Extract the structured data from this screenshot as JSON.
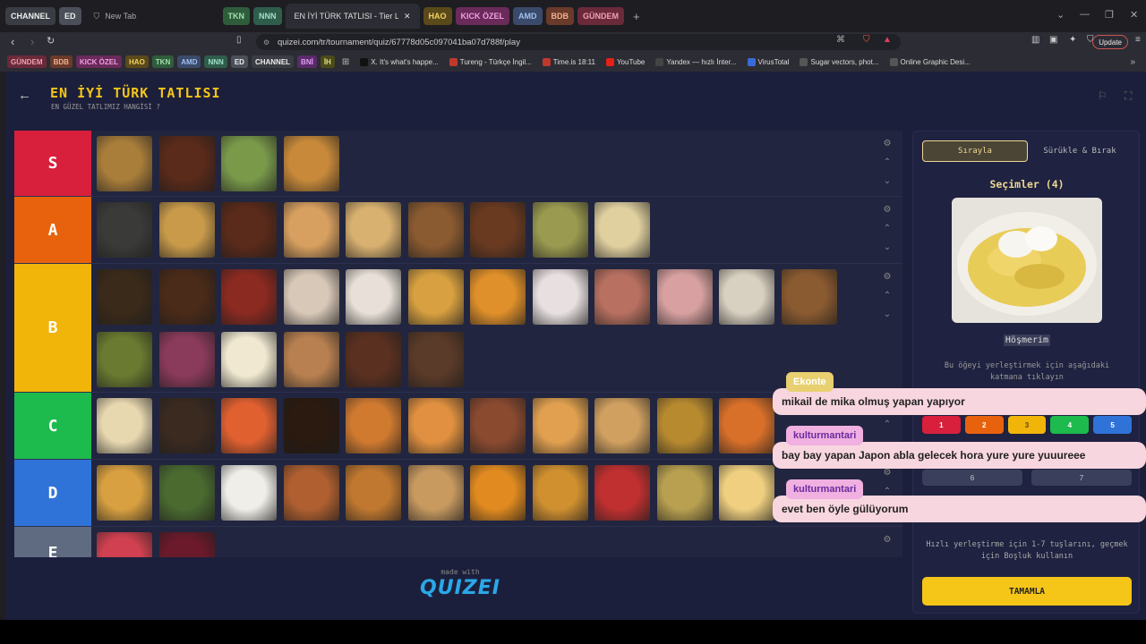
{
  "browser": {
    "tab_pills": [
      {
        "label": "CHANNEL",
        "bg": "#3a3d44",
        "fg": "#eee"
      },
      {
        "label": "ED",
        "bg": "#4a4f5a",
        "fg": "#eee"
      }
    ],
    "new_tab": "New Tab",
    "tab_pills2": [
      {
        "label": "TKN",
        "bg": "#2f5d3c",
        "fg": "#9fe0a8"
      },
      {
        "label": "NNN",
        "bg": "#2f5d4c",
        "fg": "#9fe0c8"
      }
    ],
    "active_tab": "EN İYİ TÜRK TATLISI - Tier List, K",
    "tab_pills3": [
      {
        "label": "HAO",
        "bg": "#5a4a1a",
        "fg": "#f5d060"
      },
      {
        "label": "KICK ÖZEL",
        "bg": "#6a2a5a",
        "fg": "#f0a0e0"
      },
      {
        "label": "AMD",
        "bg": "#3a4a6a",
        "fg": "#a0c0f0"
      },
      {
        "label": "BDB",
        "bg": "#6a3a2a",
        "fg": "#f0b090"
      },
      {
        "label": "GÜNDEM",
        "bg": "#6a2a3a",
        "fg": "#f0a0b0"
      }
    ],
    "url": "quizei.com/tr/tournament/quiz/67778d05c097041ba07d788f/play",
    "bookmark_pills": [
      {
        "label": "GÜNDEM",
        "bg": "#6a2a3a",
        "fg": "#f0a0b0"
      },
      {
        "label": "BDB",
        "bg": "#6a3a2a",
        "fg": "#f0b090"
      },
      {
        "label": "KICK ÖZEL",
        "bg": "#6a2a5a",
        "fg": "#f0a0e0"
      },
      {
        "label": "HAO",
        "bg": "#5a4a1a",
        "fg": "#f5d060"
      },
      {
        "label": "TKN",
        "bg": "#2f5d3c",
        "fg": "#9fe0a8"
      },
      {
        "label": "AMD",
        "bg": "#3a4a6a",
        "fg": "#a0c0f0"
      },
      {
        "label": "NNN",
        "bg": "#2f5d4c",
        "fg": "#9fe0c8"
      },
      {
        "label": "ED",
        "bg": "#4a4f5a",
        "fg": "#eee"
      },
      {
        "label": "CHANNEL",
        "bg": "#3a3d44",
        "fg": "#eee"
      },
      {
        "label": "BNİ",
        "bg": "#5a2a6a",
        "fg": "#e0a0f0"
      },
      {
        "label": "İH",
        "bg": "#4a4a1a",
        "fg": "#e0e080"
      }
    ],
    "bookmarks": [
      {
        "label": "X. It's what's happe...",
        "color": "#111"
      },
      {
        "label": "Tureng - Türkçe İngil...",
        "color": "#c0392b"
      },
      {
        "label": "Time.is 18:11",
        "color": "#c0392b"
      },
      {
        "label": "YouTube",
        "color": "#e62117"
      },
      {
        "label": "Yandex — hızlı İnter...",
        "color": "#444"
      },
      {
        "label": "VirusTotal",
        "color": "#3a6ad9"
      },
      {
        "label": "Sugar vectors, phot...",
        "color": "#555"
      },
      {
        "label": "Online Graphic Desi...",
        "color": "#555"
      }
    ],
    "update_label": "Update"
  },
  "app": {
    "title": "EN İYİ TÜRK TATLISI",
    "subtitle": "EN GÜZEL TATLIMIZ HANGİSİ ?",
    "tiers": [
      {
        "label": "S",
        "color": "#d81f3c"
      },
      {
        "label": "A",
        "color": "#e8620d"
      },
      {
        "label": "B",
        "color": "#f1b509"
      },
      {
        "label": "C",
        "color": "#1dba4e"
      },
      {
        "label": "D",
        "color": "#2f73d8"
      },
      {
        "label": "E",
        "color": "#5f6b80"
      }
    ],
    "made_with": "made with",
    "logo": "QUIZEI"
  },
  "sidebar": {
    "tab_order": "Sırayla",
    "tab_drag": "Sürükle & Bırak",
    "selections_title": "Seçimler (4)",
    "item_name": "Höşmerim",
    "instruction": "Bu öğeyi yerleştirmek için aşağıdaki katmana tıklayın",
    "tier_buttons": [
      "1",
      "2",
      "3",
      "4",
      "5"
    ],
    "tier_buttons2": [
      "6",
      "7"
    ],
    "hint": "Hızlı yerleştirme için 1-7 tuşlarını, geçmek için Boşluk kullanın",
    "done": "TAMAMLA"
  },
  "chat": [
    {
      "user": "Ekonte",
      "user_color": "#e8d070",
      "text": "mikail de mika olmuş yapan yapıyor"
    },
    {
      "user": "kulturmantari",
      "user_color": "#f0b0e0",
      "text": "bay bay yapan Japon abla gelecek hora yure yure yuuureee"
    },
    {
      "user": "kulturmantari",
      "user_color": "#f0b0e0",
      "text": "evet ben öyle gülüyorum"
    }
  ]
}
